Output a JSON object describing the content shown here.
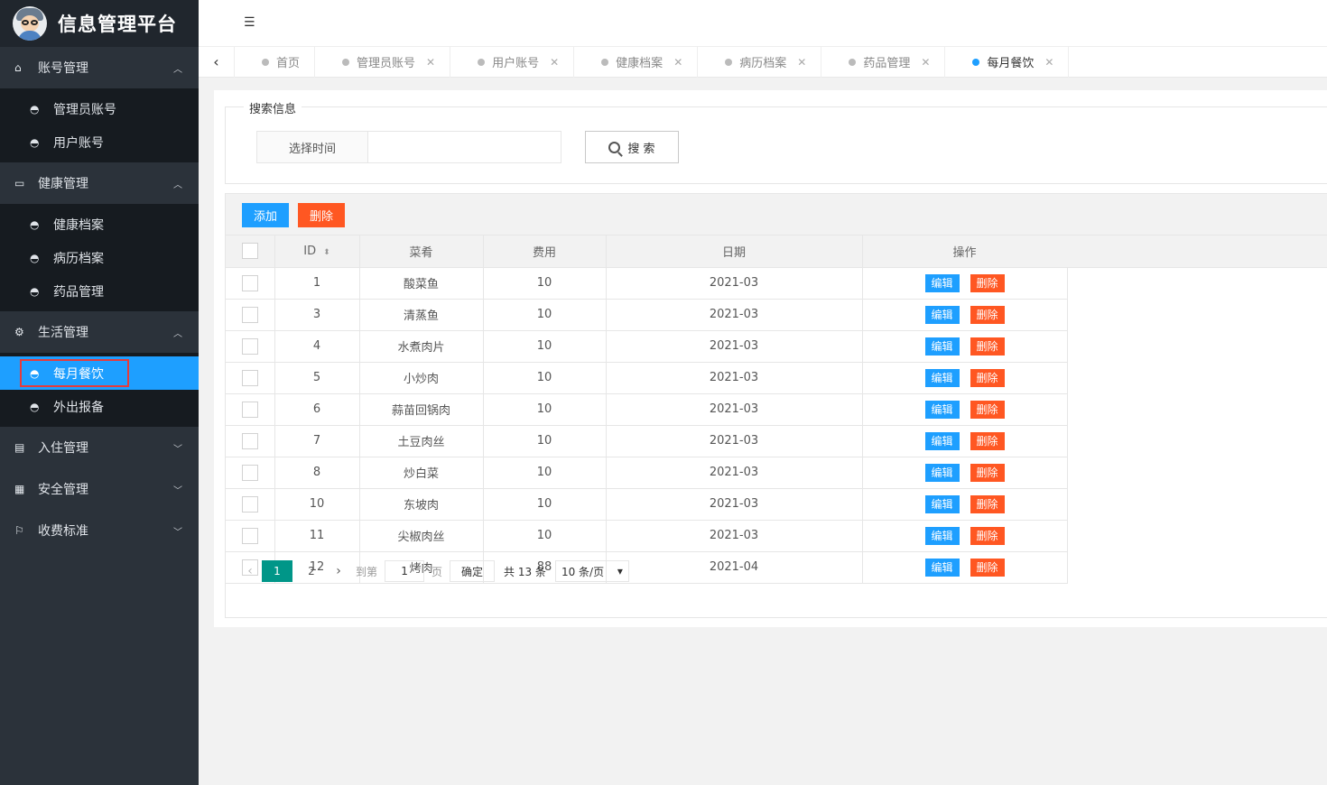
{
  "app": {
    "title": "信息管理平台"
  },
  "sidebar": {
    "groups": [
      {
        "label": "账号管理",
        "icon": "home-icon",
        "expanded": true,
        "items": [
          {
            "label": "管理员账号",
            "active": false
          },
          {
            "label": "用户账号",
            "active": false
          }
        ]
      },
      {
        "label": "健康管理",
        "icon": "window-icon",
        "expanded": true,
        "items": [
          {
            "label": "健康档案",
            "active": false
          },
          {
            "label": "病历档案",
            "active": false
          },
          {
            "label": "药品管理",
            "active": false
          }
        ]
      },
      {
        "label": "生活管理",
        "icon": "gears-icon",
        "expanded": true,
        "items": [
          {
            "label": "每月餐饮",
            "active": true
          },
          {
            "label": "外出报备",
            "active": false
          }
        ]
      },
      {
        "label": "入住管理",
        "icon": "document-icon",
        "expanded": false,
        "items": []
      },
      {
        "label": "安全管理",
        "icon": "calendar-icon",
        "expanded": false,
        "items": []
      },
      {
        "label": "收费标准",
        "icon": "flag-icon",
        "expanded": false,
        "items": []
      }
    ]
  },
  "tabs": [
    {
      "label": "首页",
      "closable": false,
      "active": false
    },
    {
      "label": "管理员账号",
      "closable": true,
      "active": false
    },
    {
      "label": "用户账号",
      "closable": true,
      "active": false
    },
    {
      "label": "健康档案",
      "closable": true,
      "active": false
    },
    {
      "label": "病历档案",
      "closable": true,
      "active": false
    },
    {
      "label": "药品管理",
      "closable": true,
      "active": false
    },
    {
      "label": "每月餐饮",
      "closable": true,
      "active": true
    }
  ],
  "search": {
    "legend": "搜索信息",
    "label": "选择时间",
    "value": "",
    "button": "搜 索"
  },
  "toolbar": {
    "add_label": "添加",
    "delete_label": "删除"
  },
  "table": {
    "columns": [
      "ID",
      "菜肴",
      "费用",
      "日期",
      "操作"
    ],
    "edit_label": "编辑",
    "delete_label": "删除",
    "rows": [
      {
        "id": "1",
        "dish": "酸菜鱼",
        "cost": "10",
        "date": "2021-03"
      },
      {
        "id": "3",
        "dish": "清蒸鱼",
        "cost": "10",
        "date": "2021-03"
      },
      {
        "id": "4",
        "dish": "水煮肉片",
        "cost": "10",
        "date": "2021-03"
      },
      {
        "id": "5",
        "dish": "小炒肉",
        "cost": "10",
        "date": "2021-03"
      },
      {
        "id": "6",
        "dish": "蒜苗回锅肉",
        "cost": "10",
        "date": "2021-03"
      },
      {
        "id": "7",
        "dish": "土豆肉丝",
        "cost": "10",
        "date": "2021-03"
      },
      {
        "id": "8",
        "dish": "炒白菜",
        "cost": "10",
        "date": "2021-03"
      },
      {
        "id": "10",
        "dish": "东坡肉",
        "cost": "10",
        "date": "2021-03"
      },
      {
        "id": "11",
        "dish": "尖椒肉丝",
        "cost": "10",
        "date": "2021-03"
      },
      {
        "id": "12",
        "dish": "烤肉",
        "cost": "88",
        "date": "2021-04"
      }
    ]
  },
  "pagination": {
    "pages": [
      "1",
      "2"
    ],
    "current": "1",
    "goto_label": "到第",
    "goto_value": "1",
    "page_label": "页",
    "confirm_label": "确定",
    "total_label": "共 13 条",
    "page_size": "10 条/页"
  },
  "colors": {
    "primary": "#1e9fff",
    "danger": "#ff5722",
    "pager_active": "#009688",
    "sidebar_bg": "#2b323a"
  }
}
